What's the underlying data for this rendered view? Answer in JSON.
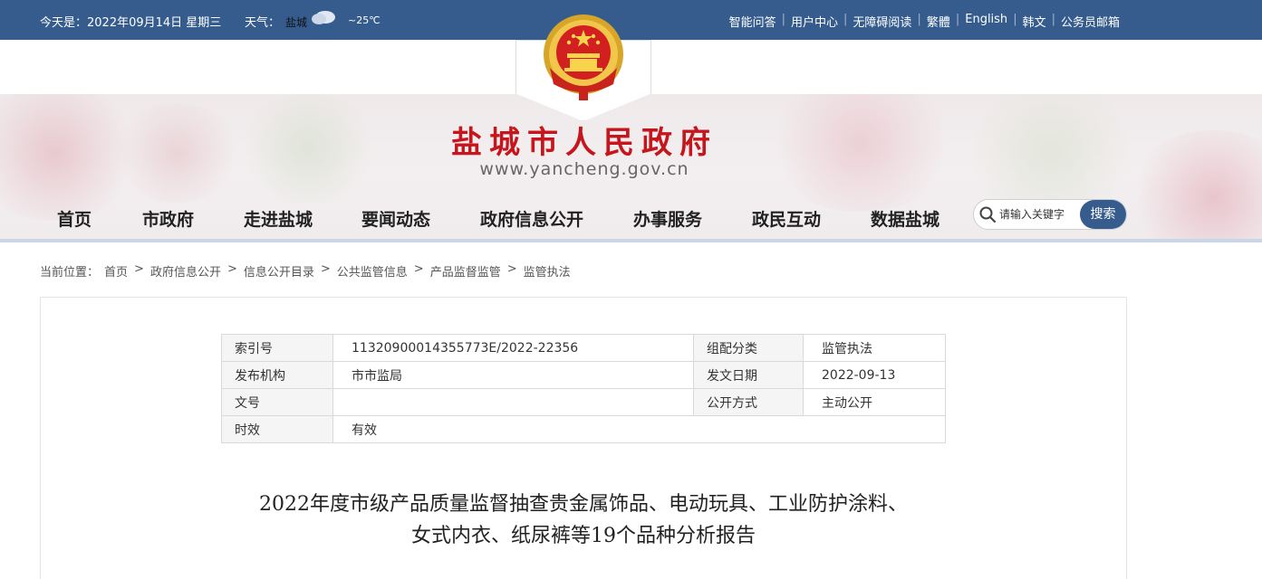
{
  "topbar": {
    "date": "今天是：2022年09月14日 星期三",
    "weather_label": "天气：",
    "city": "盐城",
    "weather_icon": "cloud-rain-icon",
    "temp": "~25℃",
    "links": [
      "智能问答",
      "用户中心",
      "无障碍阅读",
      "繁體",
      "English",
      "韩文",
      "公务员邮箱"
    ],
    "separator": "|"
  },
  "header": {
    "emblem": "national-emblem-icon",
    "site_title": "盐城市人民政府",
    "site_url": "www.yancheng.gov.cn"
  },
  "nav": {
    "items": [
      "首页",
      "市政府",
      "走进盐城",
      "要闻动态",
      "政府信息公开",
      "办事服务",
      "政民互动",
      "数据盐城"
    ],
    "search_placeholder": "请输入关键字",
    "search_button": "搜索"
  },
  "breadcrumb": {
    "label": "当前位置：",
    "items": [
      "首页",
      "政府信息公开",
      "信息公开目录",
      "公共监管信息",
      "产品监督监管",
      "监管执法"
    ],
    "separator": ">"
  },
  "meta": {
    "rows": [
      {
        "k1": "索引号",
        "v1": "11320900014355773E/2022-22356",
        "k2": "组配分类",
        "v2": "监管执法"
      },
      {
        "k1": "发布机构",
        "v1": "市市监局",
        "k2": "发文日期",
        "v2": "2022-09-13"
      },
      {
        "k1": "文号",
        "v1": "",
        "k2": "公开方式",
        "v2": "主动公开"
      },
      {
        "k1": "时效",
        "v1": "有效",
        "k2": "",
        "v2": ""
      }
    ]
  },
  "document": {
    "title_line1": "2022年度市级产品质量监督抽查贵金属饰品、电动玩具、工业防护涂料、",
    "title_line2": "女式内衣、纸尿裤等19个品种分析报告"
  },
  "colors": {
    "topbar": "#355c8c",
    "title_red": "#c4161c",
    "search_button": "#355c8c"
  }
}
